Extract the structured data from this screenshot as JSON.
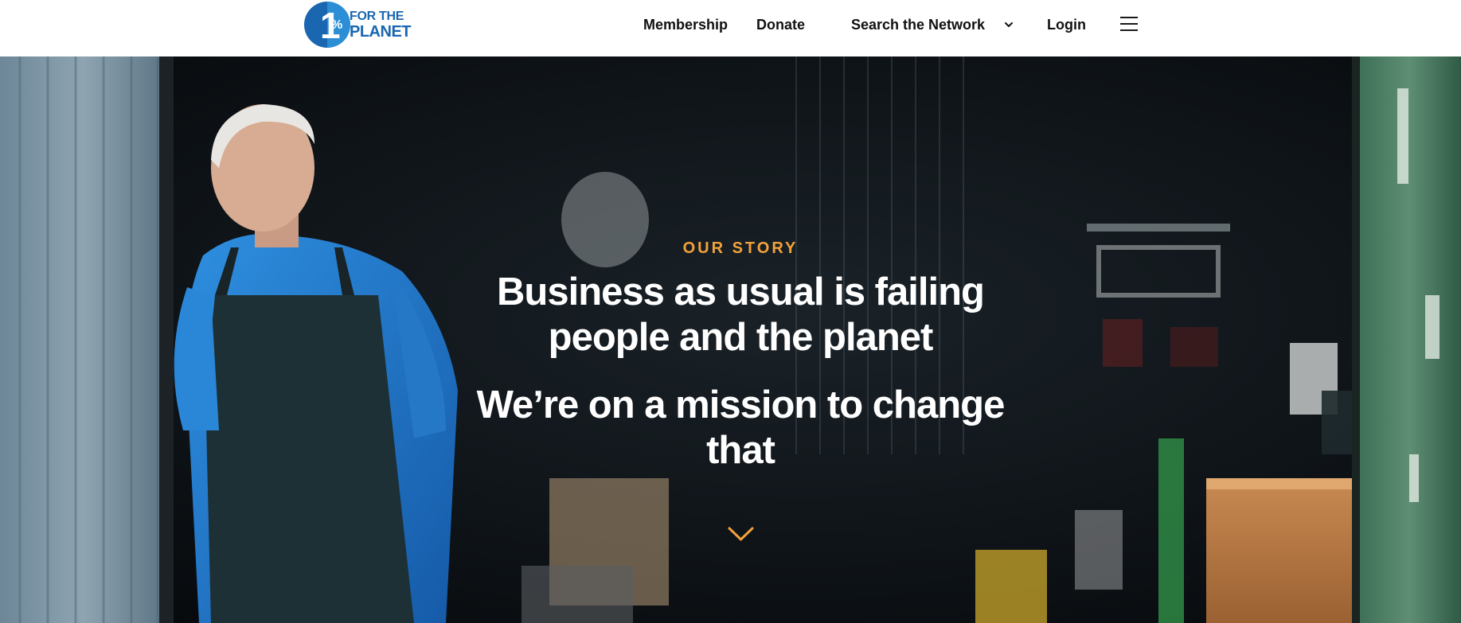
{
  "brand": {
    "logo_numeral": "1",
    "logo_percent": "%",
    "logo_line1": "FOR THE",
    "logo_line2": "PLANET",
    "colors": {
      "logo_blue": "#1a66b0",
      "logo_light_blue": "#4fb3e8",
      "accent_orange": "#f2a23b"
    }
  },
  "nav": {
    "membership": "Membership",
    "donate": "Donate",
    "search_network": "Search the Network",
    "search_icon": "chevron-down-icon",
    "login": "Login",
    "menu_icon": "hamburger-menu-icon"
  },
  "hero": {
    "eyebrow": "OUR STORY",
    "headline": "Business as usual is failing people and the planet",
    "subheadline": "We’re on a mission to change that",
    "scroll_icon": "chevron-down-icon"
  }
}
